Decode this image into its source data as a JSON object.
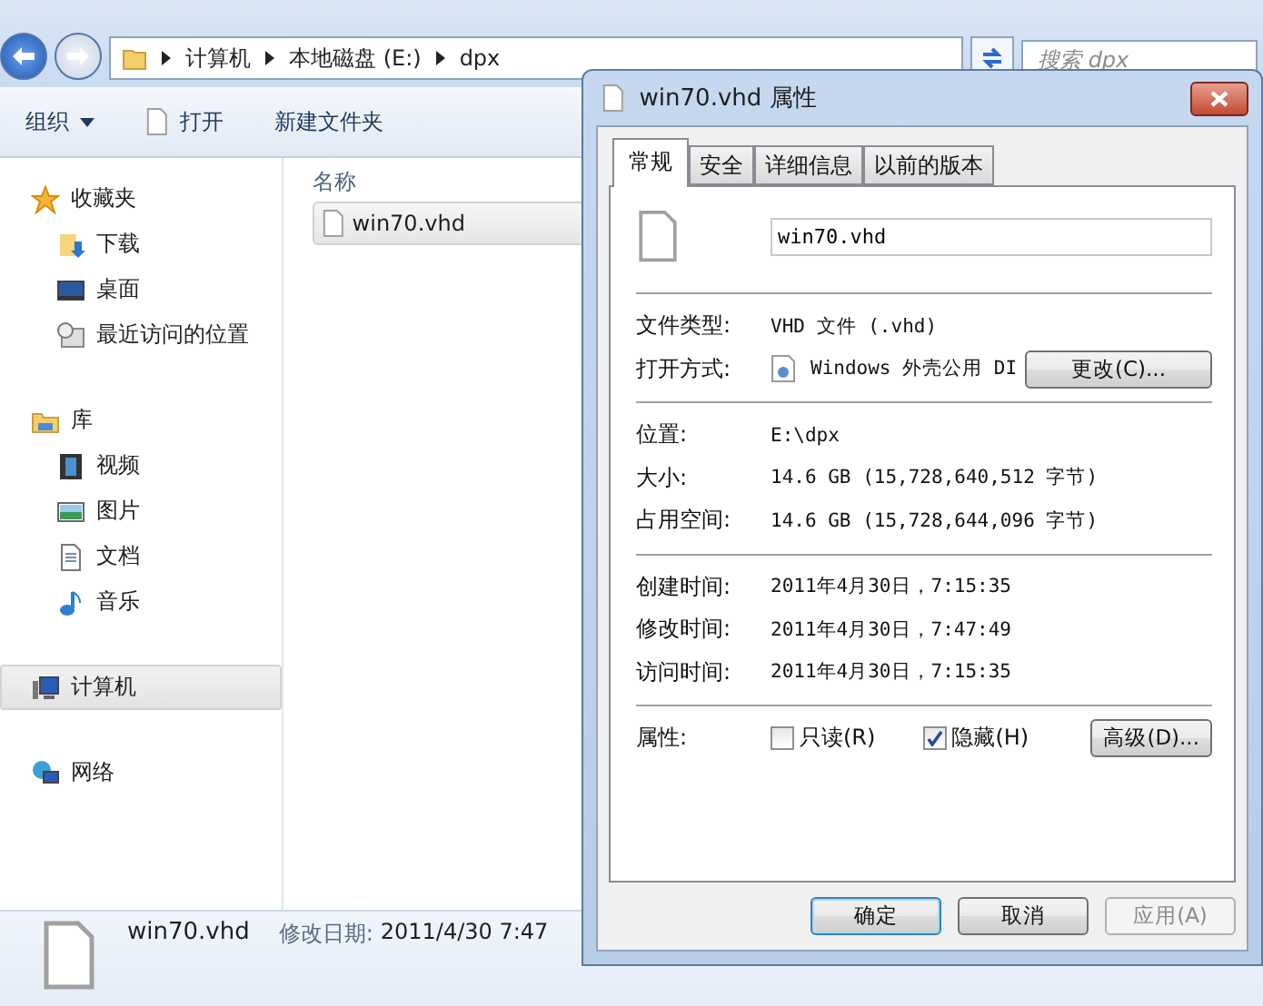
{
  "explorer": {
    "breadcrumb": [
      "计算机",
      "本地磁盘 (E:)",
      "dpx"
    ],
    "search": {
      "placeholder": "搜索 dpx"
    },
    "toolbar": [
      {
        "label": "组织",
        "kind": "menu"
      },
      {
        "label": "打开",
        "kind": "file"
      },
      {
        "label": "新建文件夹",
        "kind": "plain"
      }
    ],
    "sidebar": [
      {
        "label": "收藏夹",
        "selected": false,
        "children": [
          {
            "label": "下载",
            "selected": false
          },
          {
            "label": "桌面",
            "selected": false
          },
          {
            "label": "最近访问的位置",
            "selected": false
          }
        ]
      },
      {
        "label": "库",
        "selected": false,
        "children": [
          {
            "label": "视频",
            "selected": false
          },
          {
            "label": "图片",
            "selected": false
          },
          {
            "label": "文档",
            "selected": false
          },
          {
            "label": "音乐",
            "selected": false
          }
        ]
      },
      {
        "label": "计算机",
        "selected": true
      },
      {
        "label": "网络",
        "selected": false
      }
    ],
    "column": "名称",
    "files": [
      {
        "name": "win70.vhd",
        "selected": true
      }
    ],
    "details": {
      "name": "win70.vhd",
      "label": "修改日期:",
      "value": "2011/4/30 7:47"
    }
  },
  "dialog": {
    "title": "win70.vhd 属性",
    "tabs": [
      {
        "label": "常规",
        "selected": true
      },
      {
        "label": "安全",
        "selected": false
      },
      {
        "label": "详细信息",
        "selected": false
      },
      {
        "label": "以前的版本",
        "selected": false
      }
    ],
    "filename": "win70.vhd",
    "groups": [
      [
        {
          "label": "文件类型:",
          "value": "VHD 文件 (.vhd)",
          "kind": "text"
        },
        {
          "label": "打开方式:",
          "value": "Windows 外壳公用 DI",
          "kind": "app",
          "button": "更改(C)..."
        }
      ],
      [
        {
          "label": "位置:",
          "value": "E:\\dpx",
          "kind": "text"
        },
        {
          "label": "大小:",
          "value": "14.6 GB (15,728,640,512 字节)",
          "kind": "text"
        },
        {
          "label": "占用空间:",
          "value": "14.6 GB (15,728,644,096 字节)",
          "kind": "text"
        }
      ],
      [
        {
          "label": "创建时间:",
          "value": "2011年4月30日，7:15:35",
          "kind": "text"
        },
        {
          "label": "修改时间:",
          "value": "2011年4月30日，7:47:49",
          "kind": "text"
        },
        {
          "label": "访问时间:",
          "value": "2011年4月30日，7:15:35",
          "kind": "text"
        }
      ]
    ],
    "attributes": {
      "label": "属性:",
      "checks": [
        {
          "label": "只读(R)",
          "checked": false
        },
        {
          "label": "隐藏(H)",
          "checked": true
        }
      ],
      "button": "高级(D)..."
    },
    "buttons": [
      {
        "label": "确定",
        "default": true,
        "disabled": false
      },
      {
        "label": "取消",
        "default": false,
        "disabled": false
      },
      {
        "label": "应用(A)",
        "default": false,
        "disabled": true
      }
    ]
  }
}
